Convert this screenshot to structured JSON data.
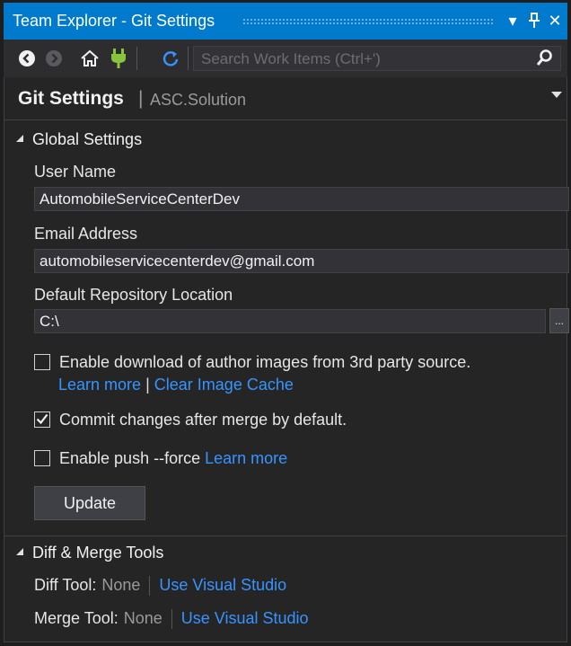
{
  "window": {
    "title": "Team Explorer - Git Settings",
    "dropdown_glyph": "▾",
    "pin_glyph": "ᛘ",
    "close_glyph": "✕"
  },
  "toolbar": {
    "icons": [
      "back-icon",
      "forward-icon",
      "home-icon",
      "connect-icon",
      "refresh-icon"
    ],
    "search_placeholder": "Search Work Items (Ctrl+')",
    "accent": "#007acc"
  },
  "header": {
    "title": "Git Settings",
    "separator": "|",
    "solution": "ASC.Solution"
  },
  "global_settings": {
    "section_label": "Global Settings",
    "user_name_label": "User Name",
    "user_name_value": "AutomobileServiceCenterDev",
    "email_label": "Email Address",
    "email_value": "automobileservicecenterdev@gmail.com",
    "repo_location_label": "Default Repository Location",
    "repo_location_value": "C:\\",
    "browse_label": "...",
    "author_images": {
      "label": "Enable download of author images from 3rd party source.",
      "checked": false,
      "learn_more": "Learn more",
      "separator": "|",
      "clear_cache": "Clear Image Cache"
    },
    "commit_after_merge": {
      "label": "Commit changes after merge by default.",
      "checked": true
    },
    "push_force": {
      "label": "Enable  push --force",
      "checked": false,
      "learn_more": "Learn more"
    },
    "update_button": "Update"
  },
  "diff_merge": {
    "section_label": "Diff & Merge Tools",
    "diff_tool_label": "Diff Tool:",
    "diff_tool_value": "None",
    "diff_tool_link": "Use Visual Studio",
    "merge_tool_label": "Merge Tool:",
    "merge_tool_value": "None",
    "merge_tool_link": "Use Visual Studio"
  },
  "colors": {
    "background": "#252526",
    "link": "#3794ff",
    "titlebar": "#007acc"
  }
}
